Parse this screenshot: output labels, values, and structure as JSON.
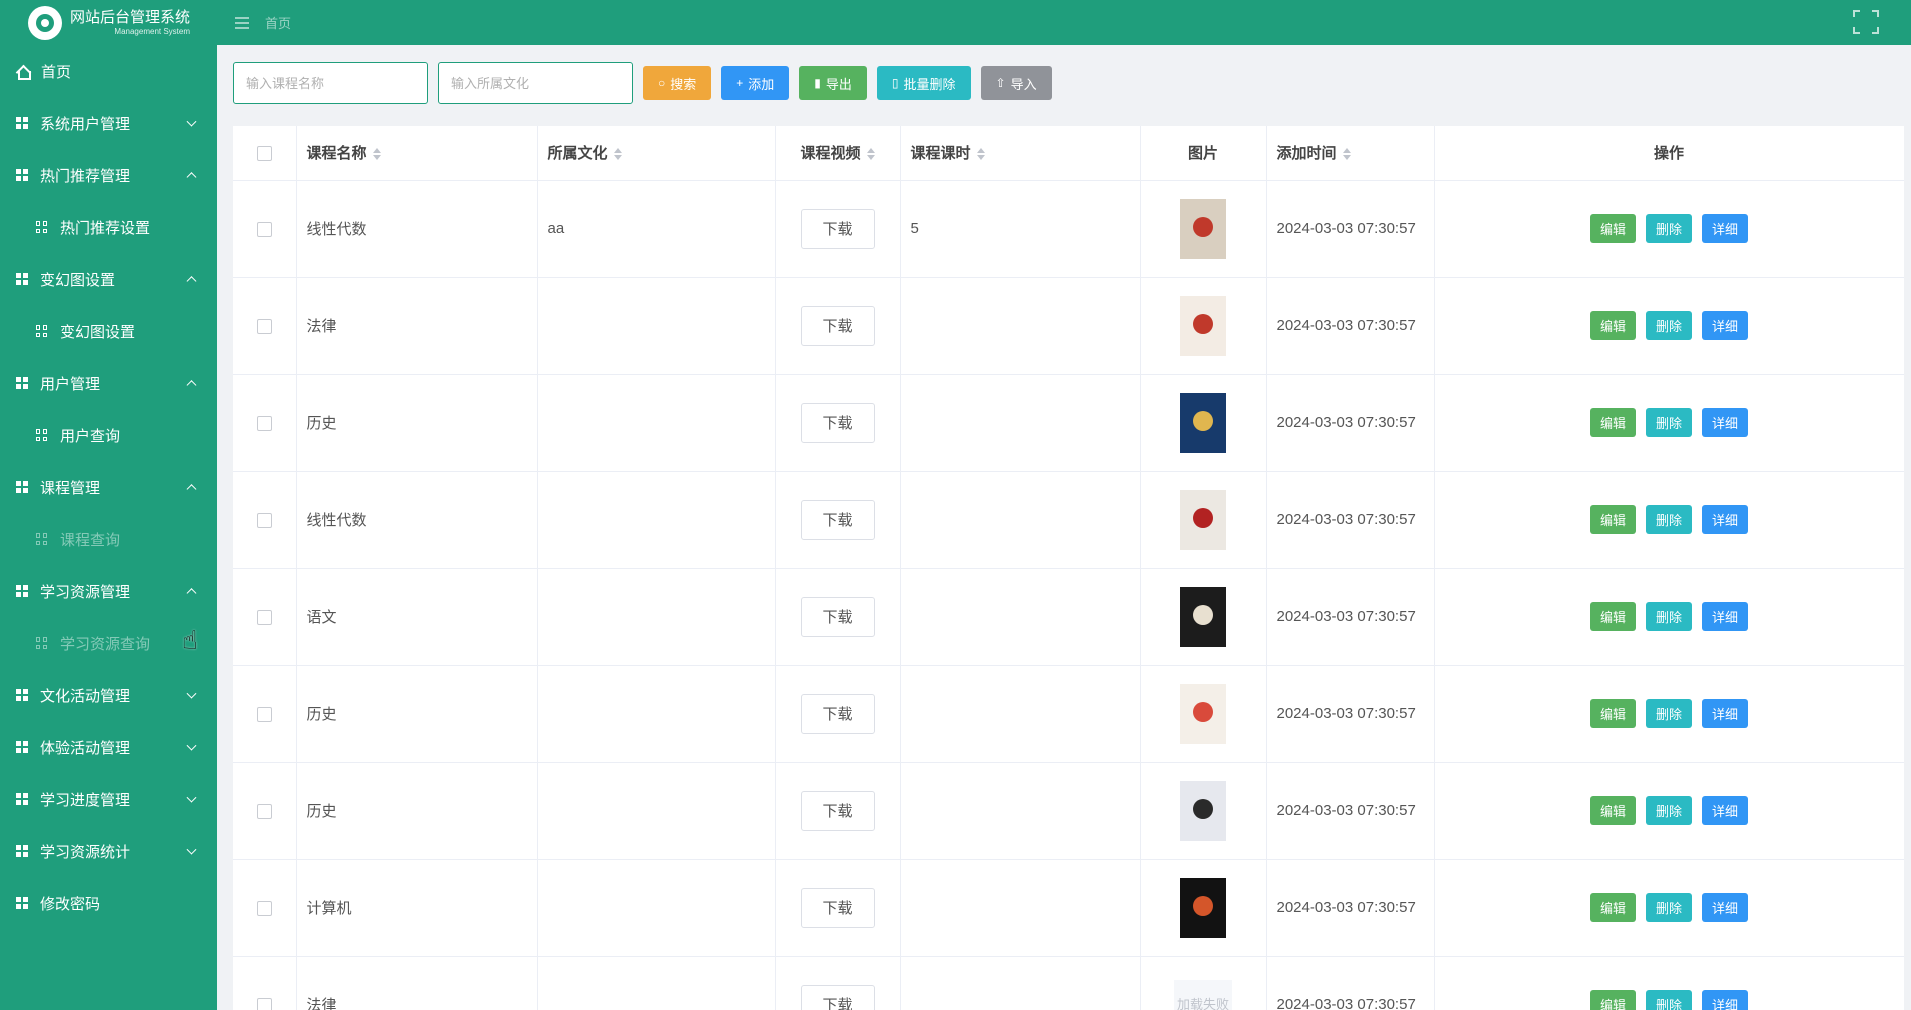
{
  "header": {
    "title": "网站后台管理系统",
    "subtitle": "Management System",
    "breadcrumb": "首页"
  },
  "sidebar": {
    "items": [
      {
        "label": "首页",
        "icon": "home-icon",
        "kind": "home"
      },
      {
        "label": "系统用户管理",
        "icon": "grid-icon",
        "kind": "group",
        "chevron": "down"
      },
      {
        "label": "热门推荐管理",
        "icon": "grid-icon",
        "kind": "group",
        "chevron": "up"
      },
      {
        "label": "热门推荐设置",
        "icon": "apps-icon",
        "kind": "sub"
      },
      {
        "label": "变幻图设置",
        "icon": "grid-icon",
        "kind": "group",
        "chevron": "up"
      },
      {
        "label": "变幻图设置",
        "icon": "apps-icon",
        "kind": "sub"
      },
      {
        "label": "用户管理",
        "icon": "grid-icon",
        "kind": "group",
        "chevron": "up"
      },
      {
        "label": "用户查询",
        "icon": "apps-icon",
        "kind": "sub"
      },
      {
        "label": "课程管理",
        "icon": "grid-icon",
        "kind": "group",
        "chevron": "up"
      },
      {
        "label": "课程查询",
        "icon": "apps-icon",
        "kind": "sub",
        "dim": true
      },
      {
        "label": "学习资源管理",
        "icon": "grid-icon",
        "kind": "group",
        "chevron": "up"
      },
      {
        "label": "学习资源查询",
        "icon": "apps-icon",
        "kind": "sub",
        "dim": true
      },
      {
        "label": "文化活动管理",
        "icon": "grid-icon",
        "kind": "group",
        "chevron": "down"
      },
      {
        "label": "体验活动管理",
        "icon": "grid-icon",
        "kind": "group",
        "chevron": "down"
      },
      {
        "label": "学习进度管理",
        "icon": "grid-icon",
        "kind": "group",
        "chevron": "down"
      },
      {
        "label": "学习资源统计",
        "icon": "grid-icon",
        "kind": "group",
        "chevron": "down"
      },
      {
        "label": "修改密码",
        "icon": "grid-icon",
        "kind": "group"
      }
    ]
  },
  "toolbar": {
    "course_name_placeholder": "输入课程名称",
    "culture_placeholder": "输入所属文化",
    "search_label": "搜索",
    "add_label": "添加",
    "export_label": "导出",
    "batch_delete_label": "批量删除",
    "import_label": "导入"
  },
  "table": {
    "headers": {
      "name": "课程名称",
      "culture": "所属文化",
      "video": "课程视频",
      "hours": "课程课时",
      "image": "图片",
      "time": "添加时间",
      "ops": "操作"
    },
    "download_label": "下载",
    "edit_label": "编辑",
    "delete_label": "删除",
    "detail_label": "详细",
    "image_fail_label": "加载失败",
    "rows": [
      {
        "name": "线性代数",
        "culture": "aa",
        "hours": "5",
        "time": "2024-03-03 07:30:57",
        "thumb": {
          "bg": "#d9cfc0",
          "accent": "#c0392b"
        }
      },
      {
        "name": "法律",
        "culture": "",
        "hours": "",
        "time": "2024-03-03 07:30:57",
        "thumb": {
          "bg": "#f3ece4",
          "accent": "#c0392b"
        }
      },
      {
        "name": "历史",
        "culture": "",
        "hours": "",
        "time": "2024-03-03 07:30:57",
        "thumb": {
          "bg": "#173a6b",
          "accent": "#e0b64f"
        }
      },
      {
        "name": "线性代数",
        "culture": "",
        "hours": "",
        "time": "2024-03-03 07:30:57",
        "thumb": {
          "bg": "#ece8e2",
          "accent": "#b22222"
        }
      },
      {
        "name": "语文",
        "culture": "",
        "hours": "",
        "time": "2024-03-03 07:30:57",
        "thumb": {
          "bg": "#1c1c1c",
          "accent": "#e8e0d0"
        }
      },
      {
        "name": "历史",
        "culture": "",
        "hours": "",
        "time": "2024-03-03 07:30:57",
        "thumb": {
          "bg": "#f4efe8",
          "accent": "#d94a3b"
        }
      },
      {
        "name": "历史",
        "culture": "",
        "hours": "",
        "time": "2024-03-03 07:30:57",
        "thumb": {
          "bg": "#e6e8ee",
          "accent": "#2a2a2a"
        }
      },
      {
        "name": "计算机",
        "culture": "",
        "hours": "",
        "time": "2024-03-03 07:30:57",
        "thumb": {
          "bg": "#121212",
          "accent": "#d4562a"
        }
      },
      {
        "name": "法律",
        "culture": "",
        "hours": "",
        "time": "2024-03-03 07:30:57",
        "thumb": null
      }
    ]
  },
  "colors": {
    "brand": "#1f9e7c",
    "edit": "#56b25f",
    "delete": "#2bbac3",
    "detail": "#3196f5",
    "search": "#f0a73b",
    "import": "#909399"
  }
}
